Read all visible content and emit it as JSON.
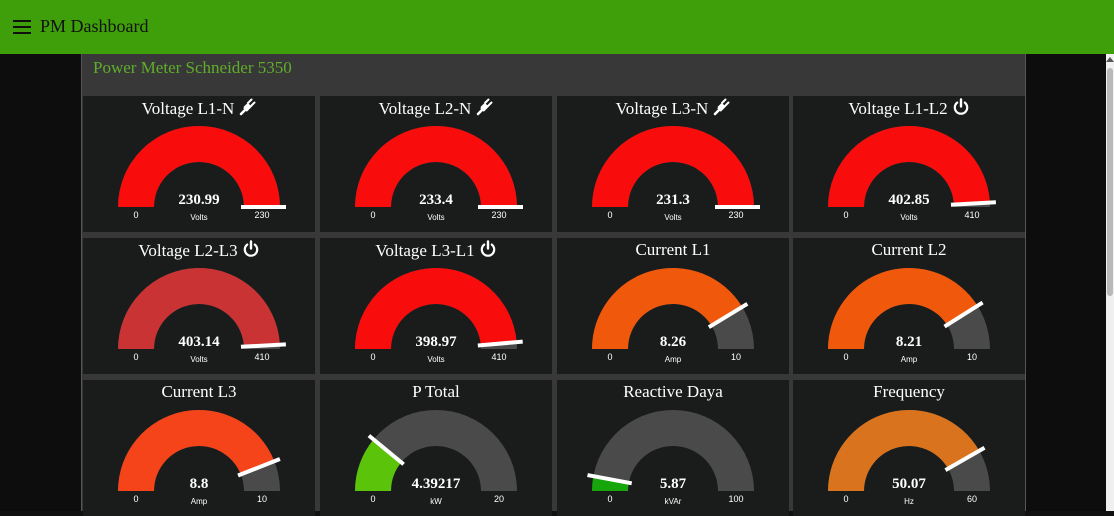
{
  "app": {
    "title": "PM Dashboard"
  },
  "group": {
    "title": "Power Meter Schneider 5350"
  },
  "colors": {
    "header": "#3f9f0a",
    "gauge_track": "#4a4a4a",
    "needle": "#ffffff"
  },
  "gauges": [
    {
      "title": "Voltage L1-N",
      "icon": "plug-icon",
      "value": 230.99,
      "display": "230.99",
      "units": "Volts",
      "min": 0,
      "max": 230,
      "min_label": "0",
      "max_label": "230",
      "color": "#f80c0c"
    },
    {
      "title": "Voltage L2-N",
      "icon": "plug-icon",
      "value": 233.4,
      "display": "233.4",
      "units": "Volts",
      "min": 0,
      "max": 230,
      "min_label": "0",
      "max_label": "230",
      "color": "#f80c0c"
    },
    {
      "title": "Voltage L3-N",
      "icon": "plug-icon",
      "value": 231.3,
      "display": "231.3",
      "units": "Volts",
      "min": 0,
      "max": 230,
      "min_label": "0",
      "max_label": "230",
      "color": "#f80c0c"
    },
    {
      "title": "Voltage L1-L2",
      "icon": "power-icon",
      "value": 402.85,
      "display": "402.85",
      "units": "Volts",
      "min": 0,
      "max": 410,
      "min_label": "0",
      "max_label": "410",
      "color": "#f80c0c"
    },
    {
      "title": "Voltage L2-L3",
      "icon": "power-icon",
      "value": 403.14,
      "display": "403.14",
      "units": "Volts",
      "min": 0,
      "max": 410,
      "min_label": "0",
      "max_label": "410",
      "color": "#c93333"
    },
    {
      "title": "Voltage L3-L1",
      "icon": "power-icon",
      "value": 398.97,
      "display": "398.97",
      "units": "Volts",
      "min": 0,
      "max": 410,
      "min_label": "0",
      "max_label": "410",
      "color": "#f80c0c"
    },
    {
      "title": "Current L1",
      "icon": "",
      "value": 8.26,
      "display": "8.26",
      "units": "Amp",
      "min": 0,
      "max": 10,
      "min_label": "0",
      "max_label": "10",
      "color": "#f0580c"
    },
    {
      "title": "Current L2",
      "icon": "",
      "value": 8.21,
      "display": "8.21",
      "units": "Amp",
      "min": 0,
      "max": 10,
      "min_label": "0",
      "max_label": "10",
      "color": "#f0580c"
    },
    {
      "title": "Current L3",
      "icon": "",
      "value": 8.8,
      "display": "8.8",
      "units": "Amp",
      "min": 0,
      "max": 10,
      "min_label": "0",
      "max_label": "10",
      "color": "#f5441a"
    },
    {
      "title": "P Total",
      "icon": "",
      "value": 4.39217,
      "display": "4.39217",
      "units": "kW",
      "min": 0,
      "max": 20,
      "min_label": "0",
      "max_label": "20",
      "color": "#5bc40a"
    },
    {
      "title": "Reactive Daya",
      "icon": "",
      "value": 5.87,
      "display": "5.87",
      "units": "kVAr",
      "min": 0,
      "max": 100,
      "min_label": "0",
      "max_label": "100",
      "color": "#16a60c"
    },
    {
      "title": "Frequency",
      "icon": "",
      "value": 50.07,
      "display": "50.07",
      "units": "Hz",
      "min": 0,
      "max": 60,
      "min_label": "0",
      "max_label": "60",
      "color": "#d9731d"
    }
  ]
}
